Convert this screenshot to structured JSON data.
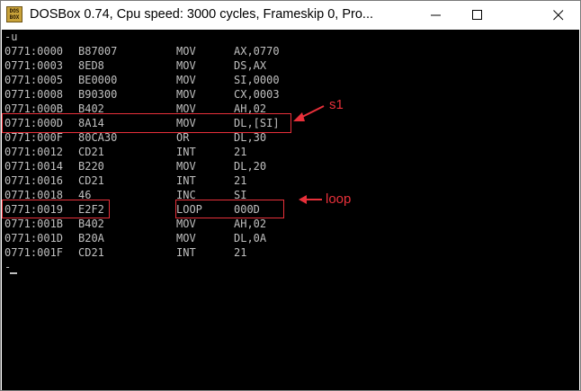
{
  "window": {
    "title": "DOSBox 0.74, Cpu speed:     3000 cycles, Frameskip  0, Pro...",
    "icon_text": [
      "DOS",
      "BOX"
    ],
    "controls": [
      "minimize-icon",
      "maximize-icon",
      "close-icon"
    ]
  },
  "console": {
    "prompt_line": "-u",
    "rows": [
      {
        "addr": "0771:0000",
        "code": "B87007",
        "mnemonic": "MOV",
        "operands": "AX,0770"
      },
      {
        "addr": "0771:0003",
        "code": "8ED8",
        "mnemonic": "MOV",
        "operands": "DS,AX"
      },
      {
        "addr": "0771:0005",
        "code": "BE0000",
        "mnemonic": "MOV",
        "operands": "SI,0000"
      },
      {
        "addr": "0771:0008",
        "code": "B90300",
        "mnemonic": "MOV",
        "operands": "CX,0003"
      },
      {
        "addr": "0771:000B",
        "code": "B402",
        "mnemonic": "MOV",
        "operands": "AH,02"
      },
      {
        "addr": "0771:000D",
        "code": "8A14",
        "mnemonic": "MOV",
        "operands": "DL,[SI]"
      },
      {
        "addr": "0771:000F",
        "code": "80CA30",
        "mnemonic": "OR",
        "operands": "DL,30"
      },
      {
        "addr": "0771:0012",
        "code": "CD21",
        "mnemonic": "INT",
        "operands": "21"
      },
      {
        "addr": "0771:0014",
        "code": "B220",
        "mnemonic": "MOV",
        "operands": "DL,20"
      },
      {
        "addr": "0771:0016",
        "code": "CD21",
        "mnemonic": "INT",
        "operands": "21"
      },
      {
        "addr": "0771:0018",
        "code": "46",
        "mnemonic": "INC",
        "operands": "SI"
      },
      {
        "addr": "0771:0019",
        "code": "E2F2",
        "mnemonic": "LOOP",
        "operands": "000D"
      },
      {
        "addr": "0771:001B",
        "code": "B402",
        "mnemonic": "MOV",
        "operands": "AH,02"
      },
      {
        "addr": "0771:001D",
        "code": "B20A",
        "mnemonic": "MOV",
        "operands": "DL,0A"
      },
      {
        "addr": "0771:001F",
        "code": "CD21",
        "mnemonic": "INT",
        "operands": "21"
      }
    ],
    "last_prompt": "-"
  },
  "annotations": {
    "s1_label": "s1",
    "loop_label": "loop",
    "color": "#e8303a"
  },
  "colors": {
    "console_bg": "#000000",
    "console_text": "#c0c0c0"
  }
}
